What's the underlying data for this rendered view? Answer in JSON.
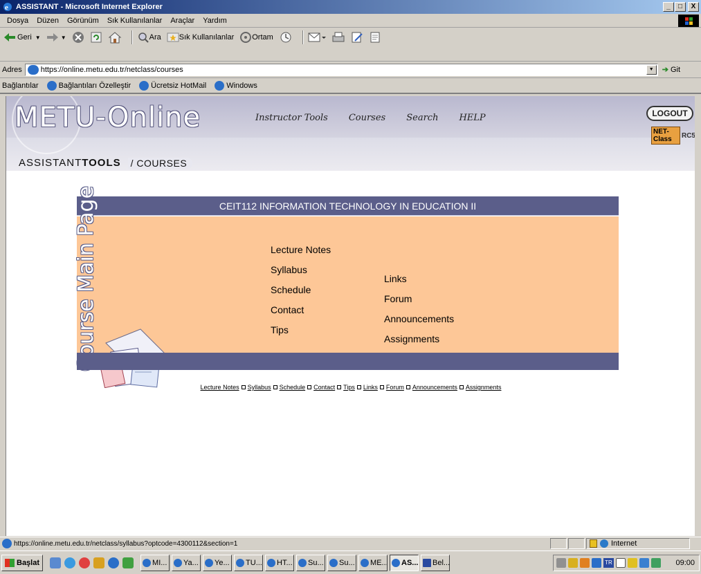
{
  "window": {
    "title": "ASSISTANT - Microsoft Internet Explorer",
    "controls": [
      "_",
      "□",
      "X"
    ]
  },
  "menubar": [
    "Dosya",
    "Düzen",
    "Görünüm",
    "Sık Kullanılanlar",
    "Araçlar",
    "Yardım"
  ],
  "toolbar": {
    "back": "Geri",
    "search": "Ara",
    "favorites": "Sık Kullanılanlar",
    "media": "Ortam"
  },
  "address": {
    "label": "Adres",
    "url": "https://online.metu.edu.tr/netclass/courses",
    "go": "Git"
  },
  "links": {
    "label": "Bağlantılar",
    "items": [
      "Bağlantıları Özelleştir",
      "Ücretsiz HotMail",
      "Windows"
    ]
  },
  "site": {
    "logo": "METU-Online",
    "nav": [
      "Instructor Tools",
      "Courses",
      "Search",
      "HELP"
    ],
    "logout": "LOGOUT",
    "badge": "NET-Class",
    "badge_version": "RC5",
    "breadcrumb_assistant": "ASSISTANT",
    "breadcrumb_tools": "TOOLS",
    "breadcrumb_courses": "/ COURSES"
  },
  "course": {
    "title": "CEIT112 INFORMATION TECHNOLOGY IN EDUCATION II",
    "side_title": "Course Main Page",
    "menu_left": [
      "Lecture Notes",
      "Syllabus",
      "Schedule",
      "Contact",
      "Tips"
    ],
    "menu_right": [
      "Links",
      "Forum",
      "Announcements",
      "Assignments"
    ],
    "footer_links": [
      "Lecture Notes",
      "Syllabus",
      "Schedule",
      "Contact",
      "Tips",
      "Links",
      "Forum",
      "Announcements",
      "Assignments"
    ]
  },
  "status": {
    "url": "https://online.metu.edu.tr/netclass/syllabus?optcode=4300112&section=1",
    "zone": "Internet"
  },
  "taskbar": {
    "start": "Başlat",
    "tasks": [
      "MI...",
      "Ya...",
      "Ye...",
      "TU...",
      "HT...",
      "Su...",
      "Su...",
      "ME...",
      "AS...",
      "Bel..."
    ],
    "active_index": 8,
    "language": "TR",
    "clock": "09:00"
  },
  "colors": {
    "panel_header": "#5b5e8a",
    "panel_body": "#fdc797",
    "header_band": "#ccccde"
  }
}
